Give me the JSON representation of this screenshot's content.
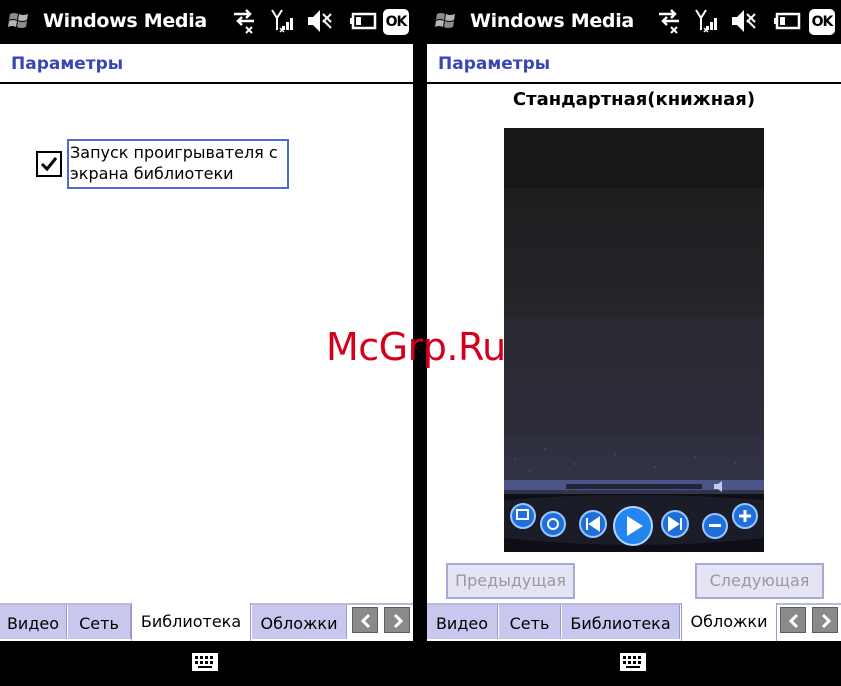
{
  "left": {
    "titlebar": {
      "app_title": "Windows Media",
      "ok_label": "OK"
    },
    "header": {
      "title": "Параметры"
    },
    "option": {
      "label": "Запуск проигрывателя с\nэкрана библиотеки",
      "checked": true
    },
    "tabs": [
      "Видео",
      "Сеть",
      "Библиотека",
      "Обложки"
    ],
    "active_tab": "Библиотека"
  },
  "right": {
    "titlebar": {
      "app_title": "Windows Media",
      "ok_label": "OK"
    },
    "header": {
      "title": "Параметры"
    },
    "skin_title": "Стандартная(книжная)",
    "prev_button": "Предыдущая",
    "next_button": "Следующая",
    "tabs": [
      "Видео",
      "Сеть",
      "Библиотека",
      "Обложки"
    ],
    "active_tab": "Обложки"
  },
  "watermark": "McGrp.Ru",
  "icons": {
    "start": "windows-flag-icon",
    "connectivity": "data-arrows-icon",
    "signal": "signal-bars-icon",
    "volume": "speaker-muted-icon",
    "battery": "battery-icon",
    "keyboard": "keyboard-icon",
    "tab_left": "chevron-left-icon",
    "tab_right": "chevron-right-icon"
  },
  "colors": {
    "header_text": "#3946b6",
    "tab_background": "#c8c8ee",
    "focus_border": "#4a6fd0",
    "watermark": "#d3001c"
  }
}
